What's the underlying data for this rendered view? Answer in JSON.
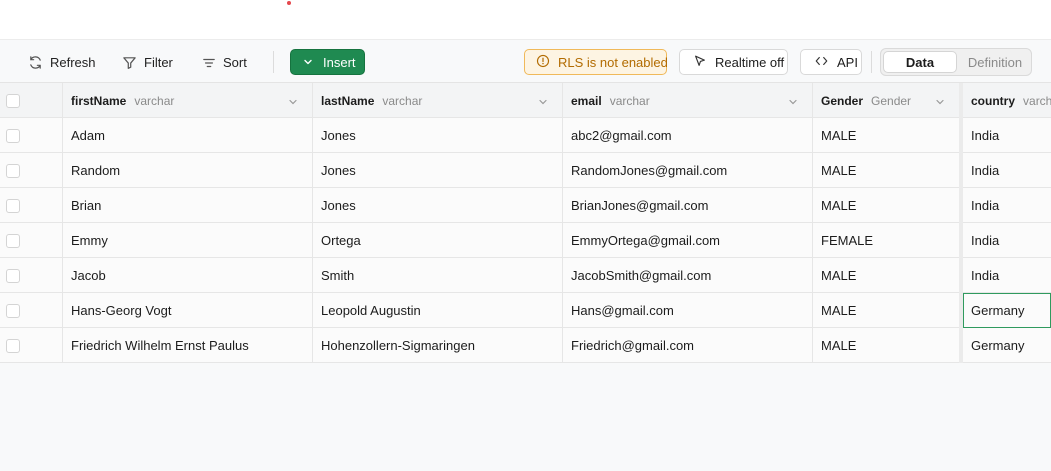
{
  "toolbar": {
    "refresh_label": "Refresh",
    "filter_label": "Filter",
    "sort_label": "Sort",
    "insert_label": "Insert",
    "rls_label": "RLS is not enabled",
    "realtime_label": "Realtime off",
    "api_label": "API",
    "view_tabs": {
      "data": "Data",
      "definition": "Definition",
      "active": "Data"
    }
  },
  "columns": [
    {
      "name": "firstName",
      "type": "varchar"
    },
    {
      "name": "lastName",
      "type": "varchar"
    },
    {
      "name": "email",
      "type": "varchar"
    },
    {
      "name": "Gender",
      "type": "Gender"
    },
    {
      "name": "country",
      "type": "varchar"
    }
  ],
  "rows": [
    [
      "Adam",
      "Jones",
      "abc2@gmail.com",
      "MALE",
      "India"
    ],
    [
      "Random",
      "Jones",
      "RandomJones@gmail.com",
      "MALE",
      "India"
    ],
    [
      "Brian",
      "Jones",
      "BrianJones@gmail.com",
      "MALE",
      "India"
    ],
    [
      "Emmy",
      "Ortega",
      "EmmyOrtega@gmail.com",
      "FEMALE",
      "India"
    ],
    [
      "Jacob",
      "Smith",
      "JacobSmith@gmail.com",
      "MALE",
      "India"
    ],
    [
      "Hans-Georg Vogt",
      "Leopold Augustin",
      "Hans@gmail.com",
      "MALE",
      "Germany"
    ],
    [
      "Friedrich Wilhelm Ernst Paulus",
      "Hohenzollern-Sigmaringen",
      "Friedrich@gmail.com",
      "MALE",
      "Germany"
    ]
  ],
  "selected_cell": {
    "row": 5,
    "column": "country"
  },
  "colors": {
    "accent": "#1f8a51",
    "warning": "#b26b00",
    "warning_bg": "#fdf4e3"
  }
}
